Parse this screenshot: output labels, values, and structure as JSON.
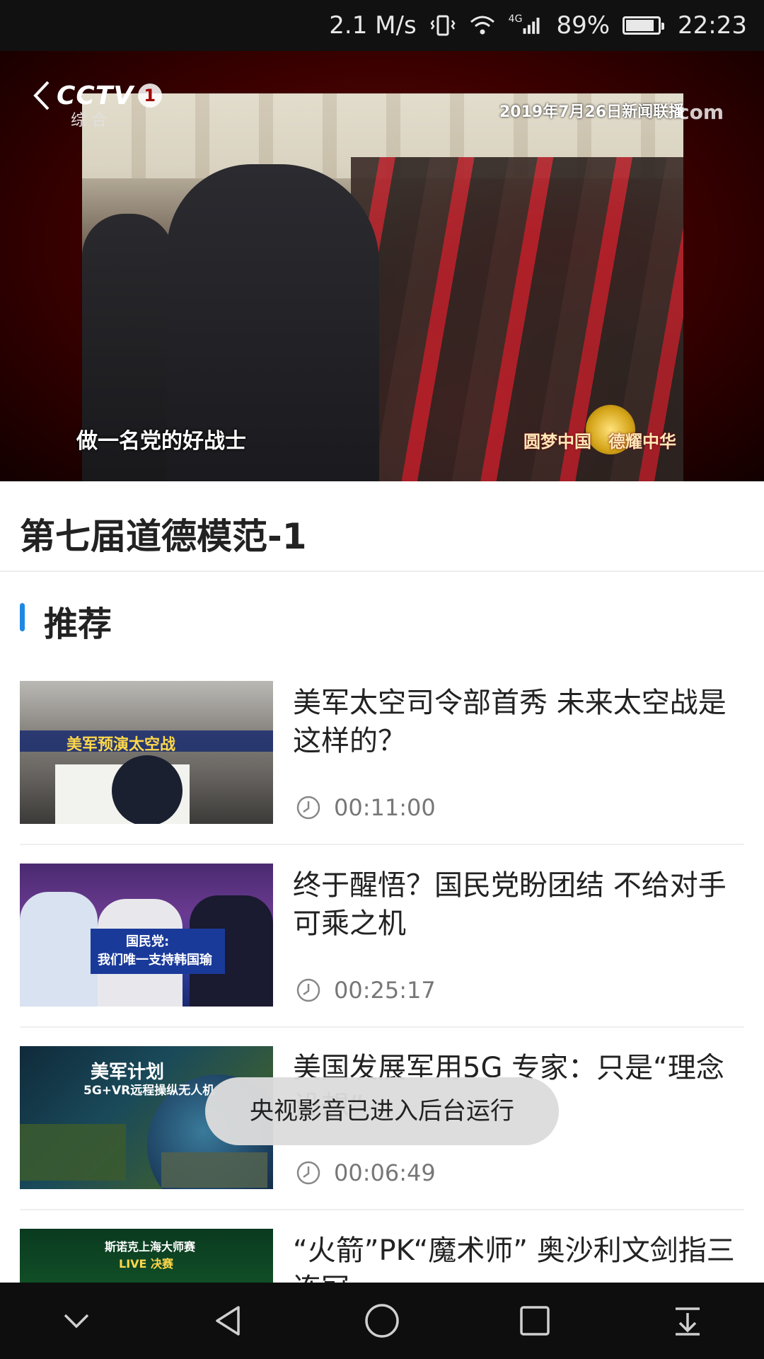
{
  "status_bar": {
    "speed": "2.1 M/s",
    "network": "4G",
    "battery": "89%",
    "battery_level": 0.89,
    "time": "22:23"
  },
  "video": {
    "channel_logo": "CCTV",
    "channel_number": "1",
    "channel_sub": "综 合",
    "watermark_date": "2019年7月26日新闻联播",
    "watermark_site": "com",
    "caption": "做一名党的好战士",
    "slogan": "圆梦中国　德耀中华"
  },
  "page_title": "第七届道德模范-1",
  "recommend_label": "推荐",
  "items": [
    {
      "title": "美军太空司令部首秀 未来太空战是这样的？",
      "duration": "00:11:00",
      "thumb_caption": "美军预演太空战"
    },
    {
      "title": "终于醒悟？国民党盼团结 不给对手可乘之机",
      "duration": "00:25:17",
      "thumb_caption": "国民党:",
      "thumb_caption2": "我们唯一支持韩国瑜"
    },
    {
      "title": "美国发展军用5G 专家：只是“理念设想”",
      "duration": "00:06:49",
      "thumb_caption": "美军计划",
      "thumb_caption2": "5G+VR远程操纵无人机"
    },
    {
      "title": "“火箭”PK“魔术师” 奥沙利文剑指三连冠",
      "duration": "",
      "thumb_caption": "斯诺克上海大师赛",
      "thumb_caption2": "LIVE 决赛"
    }
  ],
  "toast": "央视影音已进入后台运行",
  "nav_bar": {
    "icons": [
      "chevron-down-icon",
      "back-icon",
      "home-icon",
      "recents-icon",
      "notification-pull-icon"
    ]
  },
  "colors": {
    "accent": "#1e88e5",
    "title_text": "#222222",
    "meta_text": "#777777"
  }
}
